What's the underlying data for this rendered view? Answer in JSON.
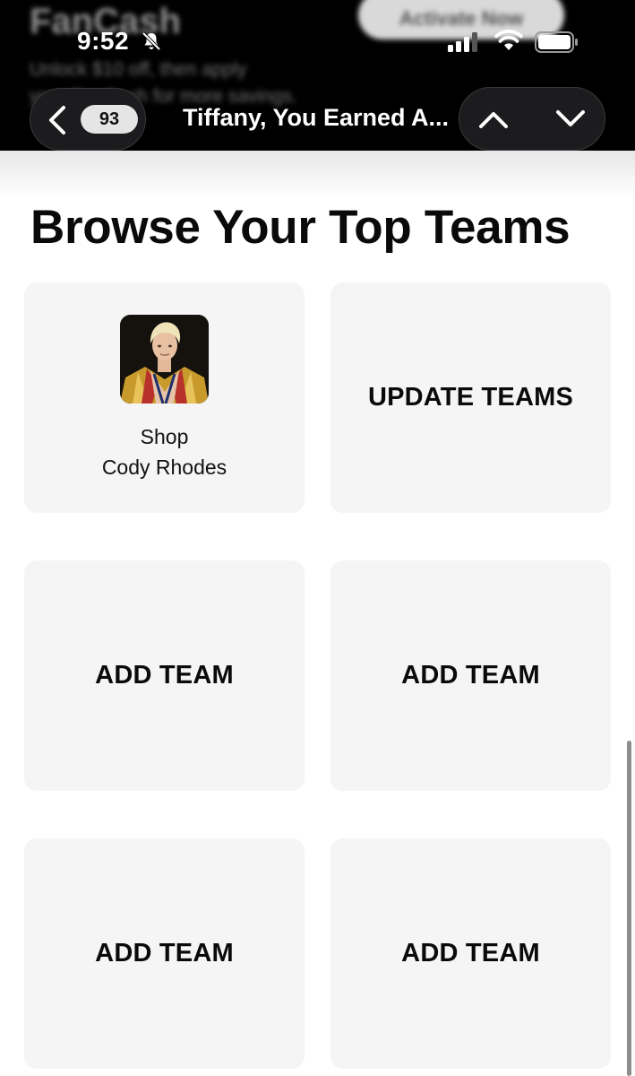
{
  "status_bar": {
    "time": "9:52"
  },
  "background_promo": {
    "brand": "FanCash",
    "line1": "Unlock $10 off, then apply",
    "line2": "your FanCash for more savings.",
    "activate_label": "Activate Now"
  },
  "nav": {
    "back_count": "93",
    "title": "Tiffany, You Earned A..."
  },
  "section": {
    "title": "Browse Your Top Teams"
  },
  "cards": [
    {
      "line1": "Shop",
      "line2": "Cody Rhodes"
    },
    {
      "label": "UPDATE TEAMS"
    },
    {
      "label": "ADD TEAM"
    },
    {
      "label": "ADD TEAM"
    },
    {
      "label": "ADD TEAM"
    },
    {
      "label": "ADD TEAM"
    }
  ],
  "colors": {
    "header_bg": "#000000",
    "card_bg": "#f5f5f5",
    "text": "#0a0a0a"
  }
}
